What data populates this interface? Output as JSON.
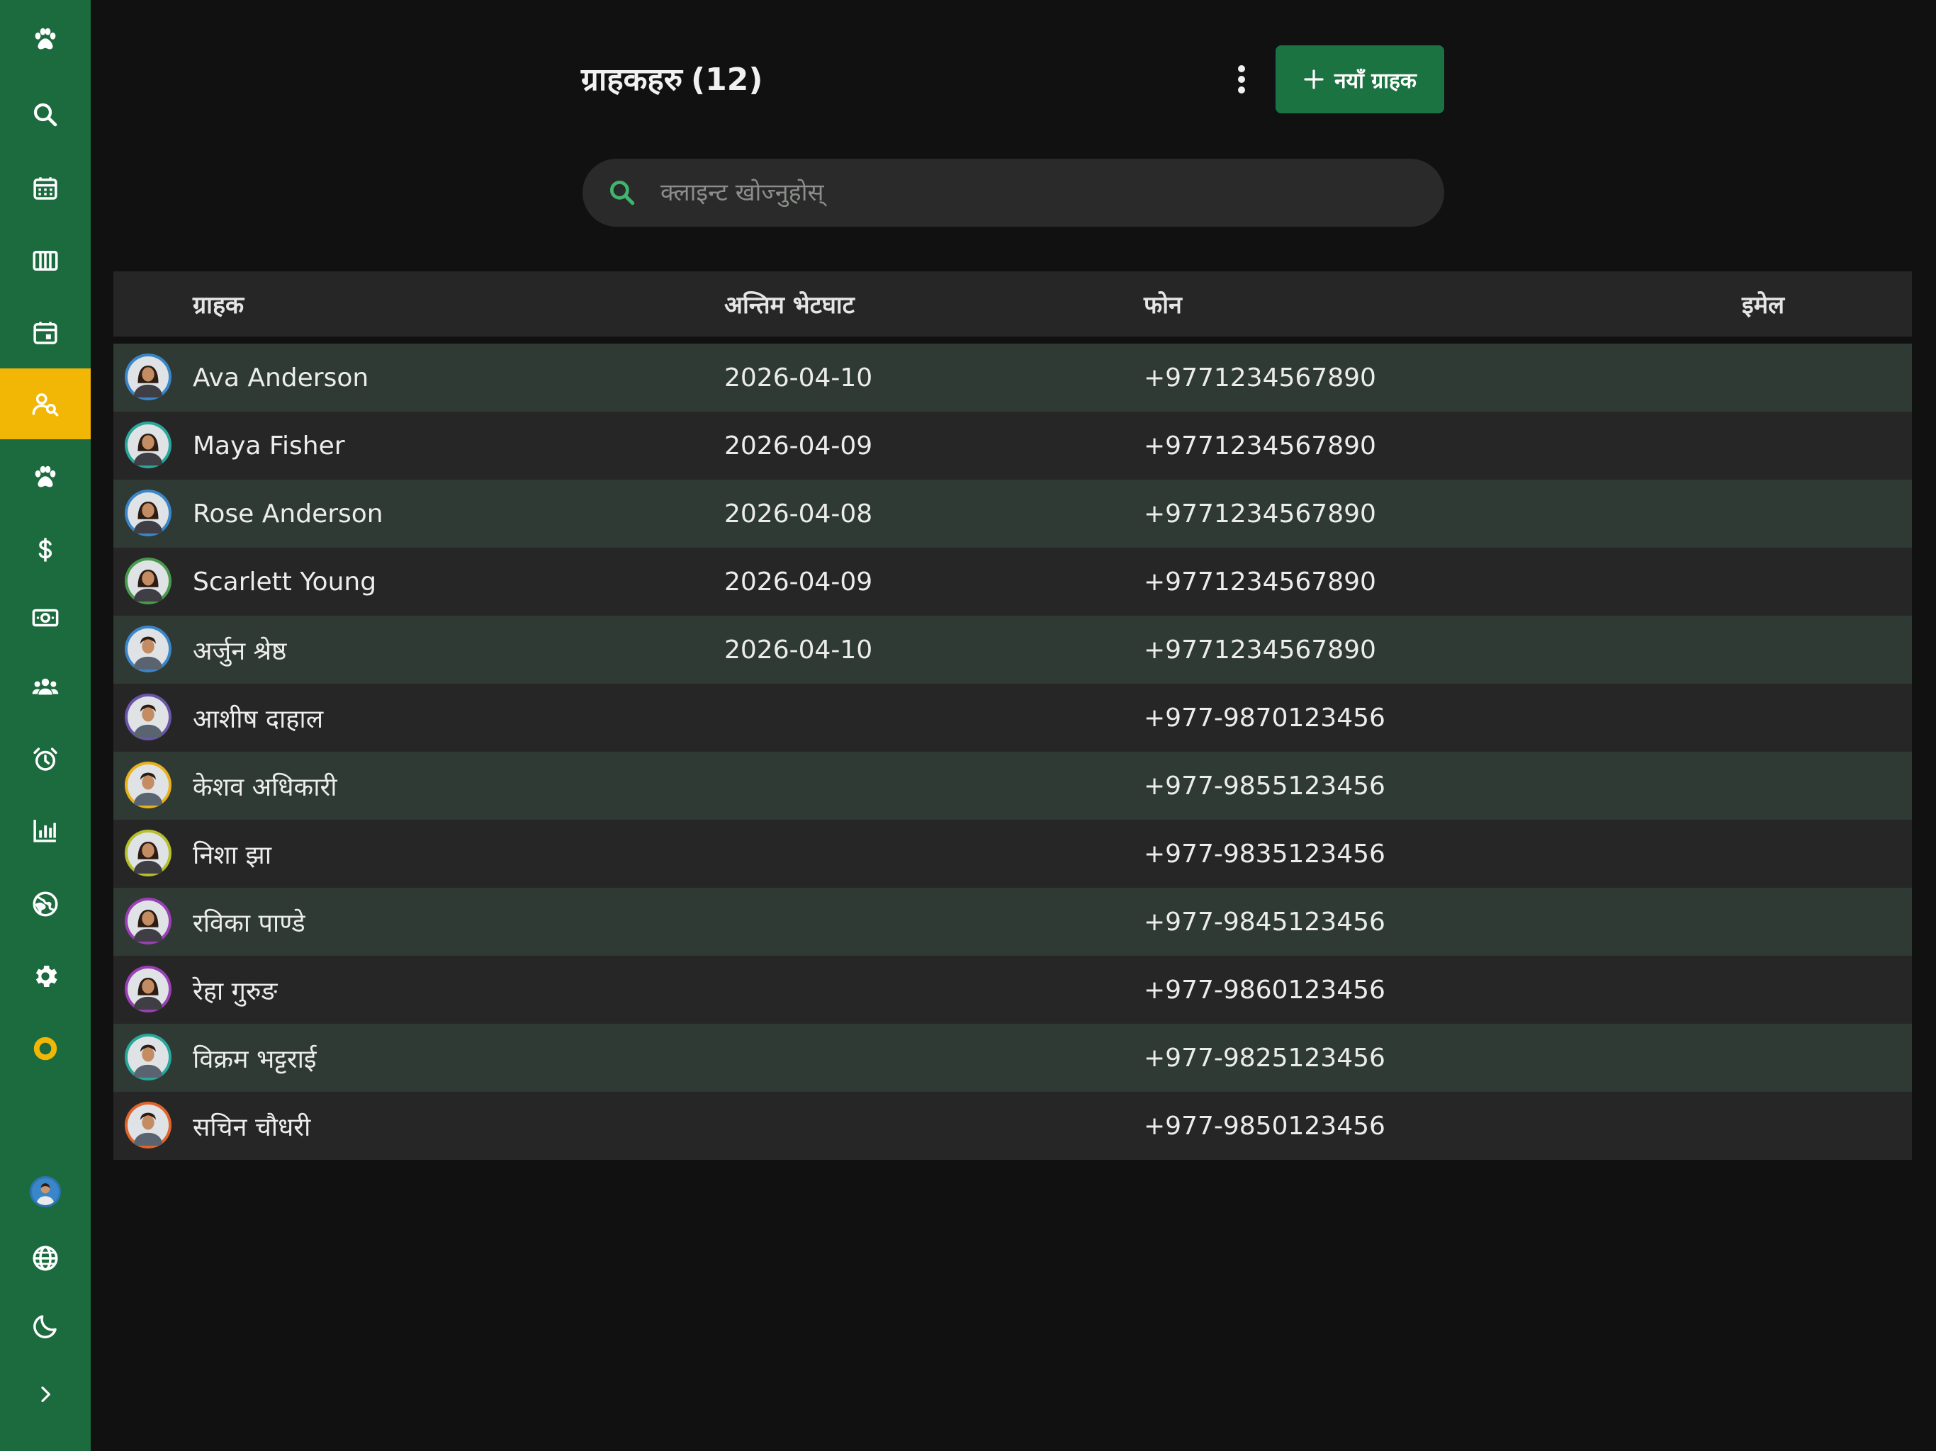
{
  "sidebar": {
    "items": [
      {
        "icon": "paw-icon"
      },
      {
        "icon": "search-icon"
      },
      {
        "icon": "calendar-grid-icon"
      },
      {
        "icon": "columns-icon"
      },
      {
        "icon": "calendar-day-icon"
      },
      {
        "icon": "clients-search-icon",
        "active": true
      },
      {
        "icon": "paw-icon"
      },
      {
        "icon": "dollar-icon"
      },
      {
        "icon": "cash-icon"
      },
      {
        "icon": "team-icon"
      },
      {
        "icon": "alarm-icon"
      },
      {
        "icon": "bar-chart-icon"
      },
      {
        "icon": "globe-icon"
      },
      {
        "icon": "gear-icon"
      },
      {
        "icon": "donut-icon"
      }
    ],
    "bottom": [
      {
        "icon": "user-avatar"
      },
      {
        "icon": "language-globe-icon"
      },
      {
        "icon": "moon-icon"
      },
      {
        "icon": "chevron-right-icon"
      }
    ],
    "accent_color": "#1b6b3e",
    "active_color": "#f2b705"
  },
  "header": {
    "title": "ग्राहकहरु",
    "count": "(12)",
    "new_client_label": "नयाँ ग्राहक"
  },
  "search": {
    "placeholder": "क्लाइन्ट खोज्नुहोस्",
    "value": ""
  },
  "table": {
    "columns": [
      "ग्राहक",
      "अन्तिम भेटघाट",
      "फोन",
      "इमेल"
    ],
    "rows": [
      {
        "name": "Ava Anderson",
        "last_visit": "2026-04-10",
        "phone": "+9771234567890",
        "email": "",
        "avatar_color": "#3a86c8"
      },
      {
        "name": "Maya Fisher",
        "last_visit": "2026-04-09",
        "phone": "+9771234567890",
        "email": "",
        "avatar_color": "#2aa79b"
      },
      {
        "name": "Rose Anderson",
        "last_visit": "2026-04-08",
        "phone": "+9771234567890",
        "email": "",
        "avatar_color": "#3a86c8"
      },
      {
        "name": "Scarlett Young",
        "last_visit": "2026-04-09",
        "phone": "+9771234567890",
        "email": "",
        "avatar_color": "#4a9a4e"
      },
      {
        "name": "अर्जुन श्रेष्ठ",
        "last_visit": "2026-04-10",
        "phone": "+9771234567890",
        "email": "",
        "avatar_color": "#3a86c8"
      },
      {
        "name": "आशीष दाहाल",
        "last_visit": "",
        "phone": "+977-9870123456",
        "email": "",
        "avatar_color": "#6b55a8"
      },
      {
        "name": "केशव अधिकारी",
        "last_visit": "",
        "phone": "+977-9855123456",
        "email": "",
        "avatar_color": "#e8b21c"
      },
      {
        "name": "निशा झा",
        "last_visit": "",
        "phone": "+977-9835123456",
        "email": "",
        "avatar_color": "#b6c02c"
      },
      {
        "name": "रविका पाण्डे",
        "last_visit": "",
        "phone": "+977-9845123456",
        "email": "",
        "avatar_color": "#9a3fb5"
      },
      {
        "name": "रेहा गुरुङ",
        "last_visit": "",
        "phone": "+977-9860123456",
        "email": "",
        "avatar_color": "#9a3fb5"
      },
      {
        "name": "विक्रम भट्टराई",
        "last_visit": "",
        "phone": "+977-9825123456",
        "email": "",
        "avatar_color": "#2aa79b"
      },
      {
        "name": "सचिन चौधरी",
        "last_visit": "",
        "phone": "+977-9850123456",
        "email": "",
        "avatar_color": "#e0642c"
      }
    ]
  }
}
